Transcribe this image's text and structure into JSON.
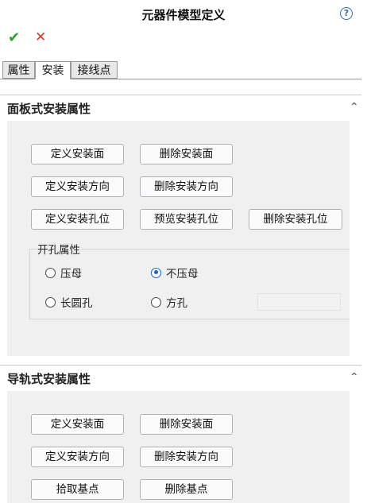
{
  "title": "元器件模型定义",
  "toolbar": {
    "help_icon": "?",
    "ok_icon": "✔",
    "cancel_icon": "✕"
  },
  "tabs": [
    {
      "label": "属性",
      "active": false
    },
    {
      "label": "安装",
      "active": true
    },
    {
      "label": "接线点",
      "active": false
    }
  ],
  "panel_mount": {
    "title": "面板式安装属性",
    "buttons": {
      "define_surface": "定义安装面",
      "delete_surface": "删除安装面",
      "define_direction": "定义安装方向",
      "delete_direction": "删除安装方向",
      "define_holes": "定义安装孔位",
      "preview_holes": "预览安装孔位",
      "delete_holes": "删除安装孔位"
    },
    "hole_group": {
      "title": "开孔属性",
      "options": [
        {
          "label": "压母",
          "checked": false
        },
        {
          "label": "不压母",
          "checked": true
        },
        {
          "label": "长圆孔",
          "checked": false
        },
        {
          "label": "方孔",
          "checked": false
        }
      ]
    }
  },
  "rail_mount": {
    "title": "导轨式安装属性",
    "buttons": {
      "define_surface": "定义安装面",
      "delete_surface": "删除安装面",
      "define_direction": "定义安装方向",
      "delete_direction": "删除安装方向",
      "pick_base": "拾取基点",
      "delete_base": "删除基点"
    }
  }
}
